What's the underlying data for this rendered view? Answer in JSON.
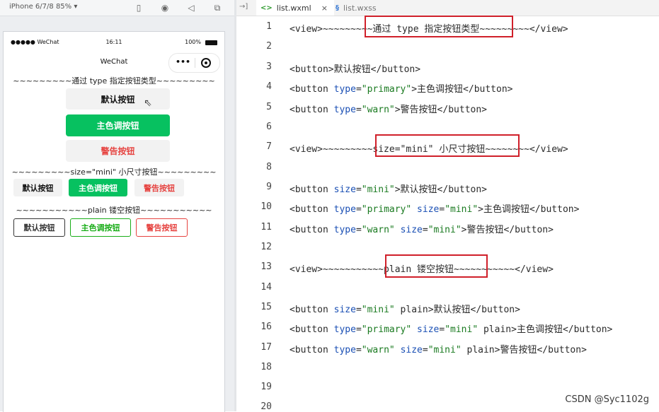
{
  "simulator": {
    "device_label": "iPhone 6/7/8 85% ▾",
    "toolbar_icons": [
      "phone-icon",
      "record-icon",
      "sound-icon",
      "window-icon"
    ],
    "status_bar": {
      "signal": "●●●●● WeChat",
      "time": "16:11",
      "battery": "100%"
    },
    "nav_title": "WeChat",
    "capsule_dots": "•••",
    "lines": {
      "type_heading": "~~~~~~~~~通过 type 指定按钮类型~~~~~~~~~",
      "size_heading": "~~~~~~~~~size=\"mini\" 小尺寸按钮~~~~~~~~~",
      "plain_heading": "~~~~~~~~~~~plain 镂空按钮~~~~~~~~~~~"
    },
    "buttons": {
      "default": "默认按钮",
      "primary": "主色调按钮",
      "warn": "警告按钮"
    }
  },
  "editor": {
    "split_icon": "→]",
    "tabs": [
      {
        "label": "list.wxml",
        "icon": "wxml-file-icon",
        "close": "×"
      },
      {
        "label": "list.wxss",
        "icon": "wxss-file-icon"
      }
    ],
    "line_numbers": [
      "1",
      "2",
      "3",
      "4",
      "5",
      "6",
      "7",
      "8",
      "9",
      "10",
      "11",
      "12",
      "13",
      "14",
      "15",
      "16",
      "17",
      "18",
      "19",
      "20"
    ],
    "code": {
      "l1_open": "<view>~~~~~~~~",
      "l1_mid": "~通过 type 指定按钮类型~",
      "l1_close": "~~~~~~~~</view>",
      "l3": "<button>默认按钮</button>",
      "l4_a": "<button ",
      "l4_attr": "type",
      "l4_eq": "=",
      "l4_str": "\"primary\"",
      "l4_b": ">主色调按钮</button>",
      "l5_a": "<button ",
      "l5_attr": "type",
      "l5_eq": "=",
      "l5_str": "\"warn\"",
      "l5_b": ">警告按钮</button>",
      "l7_open": "<view>~~~~~~~~",
      "l7_mid": "~size=\"mini\" 小尺寸按钮~",
      "l7_close": "~~~~~~~</view>",
      "l9_a": "<button ",
      "l9_attr": "size",
      "l9_eq": "=",
      "l9_str": "\"mini\"",
      "l9_b": ">默认按钮</button>",
      "l10_a": "<button ",
      "l10_attr1": "type",
      "l10_eq1": "=",
      "l10_str1": "\"primary\"",
      "l10_sp": " ",
      "l10_attr2": "size",
      "l10_eq2": "=",
      "l10_str2": "\"mini\"",
      "l10_b": ">主色调按钮</button>",
      "l11_a": "<button ",
      "l11_attr1": "type",
      "l11_eq1": "=",
      "l11_str1": "\"warn\"",
      "l11_sp": " ",
      "l11_attr2": "size",
      "l11_eq2": "=",
      "l11_str2": "\"mini\"",
      "l11_b": ">警告按钮</button>",
      "l13_open": "<view>~~~~~~~~~~",
      "l13_mid": "~plain 镂空按钮~",
      "l13_close": "~~~~~~~~~~</view>",
      "l15_a": "<button ",
      "l15_attr": "size",
      "l15_eq": "=",
      "l15_str": "\"mini\"",
      "l15_b": " plain>默认按钮</button>",
      "l16_a": "<button ",
      "l16_attr1": "type",
      "l16_eq1": "=",
      "l16_str1": "\"primary\"",
      "l16_sp": " ",
      "l16_attr2": "size",
      "l16_eq2": "=",
      "l16_str2": "\"mini\"",
      "l16_b": " plain>主色调按钮</button>",
      "l17_a": "<button ",
      "l17_attr1": "type",
      "l17_eq1": "=",
      "l17_str1": "\"warn\"",
      "l17_sp": " ",
      "l17_attr2": "size",
      "l17_eq2": "=",
      "l17_str2": "\"mini\"",
      "l17_b": " plain>警告按钮</button>"
    }
  },
  "watermark": "CSDN @Syc1102g",
  "colors": {
    "primary_green": "#07c160",
    "warn_red": "#e64340",
    "highlight_red": "#d0202a",
    "attr_blue": "#1a4fb4",
    "string_green": "#1a7a20"
  }
}
